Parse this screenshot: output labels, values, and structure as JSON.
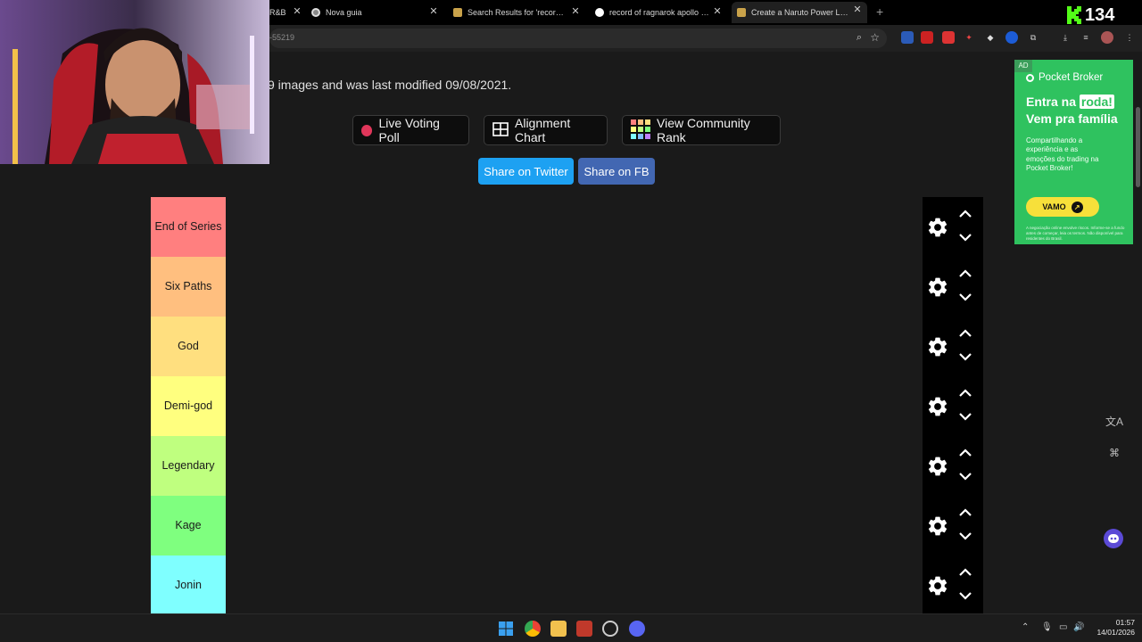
{
  "browser": {
    "tabs": [
      {
        "title": "R&B",
        "active": false
      },
      {
        "title": "Nova guia",
        "active": false
      },
      {
        "title": "Search Results for 'record of rag",
        "active": false
      },
      {
        "title": "record of ragnarok apollo vs le",
        "active": false
      },
      {
        "title": "Create a Naruto Power Levels T",
        "active": true
      }
    ],
    "new_tab_icon": "+",
    "url": "-55219"
  },
  "page": {
    "info_text": "9 images and was last modified 09/08/2021.",
    "action_buttons": [
      {
        "label": "Live Voting Poll",
        "icon": "red-dot-icon"
      },
      {
        "label": "Alignment Chart",
        "icon": "grid-icon"
      },
      {
        "label": "View Community Rank",
        "icon": "color-grid-icon"
      }
    ],
    "share_buttons": [
      {
        "label": "Share on Twitter",
        "color": "#1da1f2"
      },
      {
        "label": "Share on FB",
        "color": "#4267b2"
      }
    ],
    "tiers": [
      {
        "label": "End of Series",
        "color": "#ff7f7f"
      },
      {
        "label": "Six Paths",
        "color": "#ffbf7f"
      },
      {
        "label": "God",
        "color": "#ffdf7f"
      },
      {
        "label": "Demi-god",
        "color": "#ffff7f"
      },
      {
        "label": "Legendary",
        "color": "#bfff7f"
      },
      {
        "label": "Kage",
        "color": "#7fff7f"
      },
      {
        "label": "Jonin",
        "color": "#7fffff"
      }
    ]
  },
  "ad": {
    "tag": "AD",
    "brand": "Pocket Broker",
    "headline_pre": "Entra na ",
    "headline_highlight": "roda!",
    "headline_2": "Vem pra família",
    "body": "Compartilhando a experiência e as emoções do trading na Pocket Broker!",
    "cta": "VAMO",
    "fine_print": "A negociação online envolve riscos. Informe-se a fundo antes de começar, leia os termos. Não disponível para residentes do Brasil."
  },
  "overlay": {
    "viewer_count": "134"
  },
  "taskbar": {
    "time": "01:57",
    "date": "14/01/2026"
  }
}
